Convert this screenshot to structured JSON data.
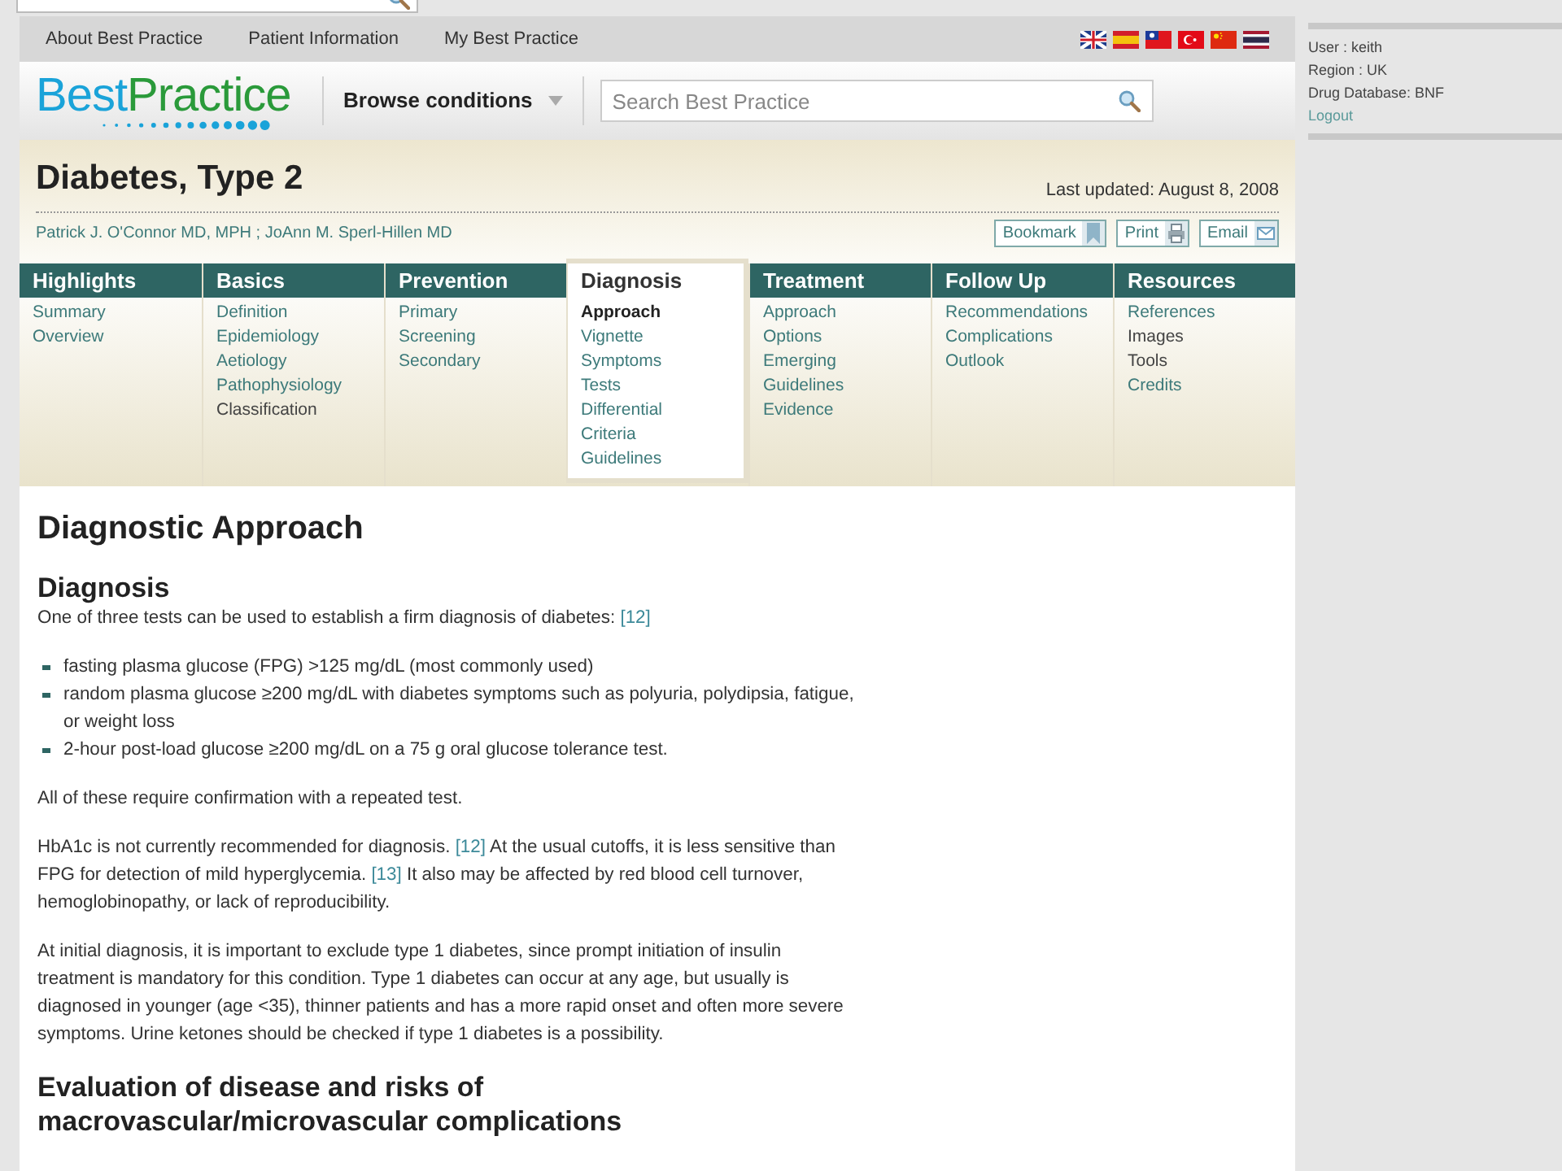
{
  "top_nav": [
    "About Best Practice",
    "Patient Information",
    "My Best Practice"
  ],
  "logo": {
    "part_1": "Best",
    "part_2": "Practice"
  },
  "browse": "Browse conditions",
  "search": {
    "placeholder": "Search Best Practice"
  },
  "title": "Diabetes, Type 2",
  "last_updated": "Last updated: August 8, 2008",
  "authors": "Patrick J. O'Connor MD, MPH ; JoAnn M. Sperl-Hillen MD",
  "actions": [
    "Bookmark",
    "Print",
    "Email"
  ],
  "menu": [
    {
      "heading": "Highlights",
      "selected": false,
      "items": [
        {
          "label": "Summary",
          "linked": true,
          "selected": false
        },
        {
          "label": "Overview",
          "linked": true,
          "selected": false
        }
      ]
    },
    {
      "heading": "Basics",
      "selected": false,
      "items": [
        {
          "label": "Definition",
          "linked": true,
          "selected": false
        },
        {
          "label": "Epidemiology",
          "linked": true,
          "selected": false
        },
        {
          "label": "Aetiology",
          "linked": true,
          "selected": false
        },
        {
          "label": "Pathophysiology",
          "linked": true,
          "selected": false
        },
        {
          "label": "Classification",
          "linked": false,
          "selected": false
        }
      ]
    },
    {
      "heading": "Prevention",
      "selected": false,
      "items": [
        {
          "label": "Primary",
          "linked": true,
          "selected": false
        },
        {
          "label": "Screening",
          "linked": true,
          "selected": false
        },
        {
          "label": "Secondary",
          "linked": true,
          "selected": false
        }
      ]
    },
    {
      "heading": "Diagnosis",
      "selected": true,
      "items": [
        {
          "label": "Approach",
          "linked": true,
          "selected": true
        },
        {
          "label": "Vignette",
          "linked": true,
          "selected": false
        },
        {
          "label": "Symptoms",
          "linked": true,
          "selected": false
        },
        {
          "label": "Tests",
          "linked": true,
          "selected": false
        },
        {
          "label": "Differential",
          "linked": true,
          "selected": false
        },
        {
          "label": "Criteria",
          "linked": true,
          "selected": false
        },
        {
          "label": "Guidelines",
          "linked": true,
          "selected": false
        }
      ]
    },
    {
      "heading": "Treatment",
      "selected": false,
      "items": [
        {
          "label": "Approach",
          "linked": true,
          "selected": false
        },
        {
          "label": "Options",
          "linked": true,
          "selected": false
        },
        {
          "label": "Emerging",
          "linked": true,
          "selected": false
        },
        {
          "label": "Guidelines",
          "linked": true,
          "selected": false
        },
        {
          "label": "Evidence",
          "linked": true,
          "selected": false
        }
      ]
    },
    {
      "heading": "Follow Up",
      "selected": false,
      "items": [
        {
          "label": "Recommendations",
          "linked": true,
          "selected": false
        },
        {
          "label": "Complications",
          "linked": true,
          "selected": false
        },
        {
          "label": "Outlook",
          "linked": true,
          "selected": false
        }
      ]
    },
    {
      "heading": "Resources",
      "selected": false,
      "items": [
        {
          "label": "References",
          "linked": true,
          "selected": false
        },
        {
          "label": "Images",
          "linked": false,
          "selected": false
        },
        {
          "label": "Tools",
          "linked": false,
          "selected": false
        },
        {
          "label": "Credits",
          "linked": true,
          "selected": false
        }
      ]
    }
  ],
  "content": [
    {
      "kind": "h1",
      "text": "Diagnostic Approach"
    },
    {
      "kind": "h2",
      "text": "Diagnosis"
    },
    {
      "kind": "p",
      "parts": [
        {
          "kind": "text",
          "text": "One of three tests can be used to establish a firm diagnosis of diabetes:"
        },
        {
          "kind": "ref",
          "text": "[12]"
        }
      ]
    },
    {
      "kind": "list",
      "items": [
        "fasting plasma glucose (FPG) >125 mg/dL (most commonly used)",
        "random plasma glucose ≥200 mg/dL with diabetes symptoms such as polyuria, polydipsia, fatigue, or weight loss",
        "2-hour post-load glucose ≥200 mg/dL on a 75 g oral glucose tolerance test."
      ]
    },
    {
      "kind": "p",
      "parts": [
        {
          "kind": "text",
          "text": "All of these require confirmation with a repeated test."
        }
      ]
    },
    {
      "kind": "p",
      "parts": [
        {
          "kind": "text",
          "text": "HbA1c is not currently recommended for diagnosis."
        },
        {
          "kind": "ref",
          "text": "[12]"
        },
        {
          "kind": "text",
          "text": "At the usual cutoffs, it is less sensitive than FPG for detection of mild hyperglycemia."
        },
        {
          "kind": "ref",
          "text": "[13]"
        },
        {
          "kind": "text",
          "text": "It also may be affected by red blood cell turnover, hemoglobinopathy, or lack of reproducibility."
        }
      ]
    },
    {
      "kind": "p",
      "parts": [
        {
          "kind": "text",
          "text": "At initial diagnosis, it is important to exclude type 1 diabetes, since prompt initiation of insulin treatment is mandatory for this condition. Type 1 diabetes can occur at any age, but usually is diagnosed in younger (age <35), thinner patients and has a more rapid onset and often more severe symptoms. Urine ketones should be checked if type 1 diabetes is a possibility."
        }
      ]
    },
    {
      "kind": "h2",
      "text": "Evaluation of disease and risks of macrovascular/microvascular complications"
    }
  ],
  "user_panel": {
    "lines": [
      "User : keith",
      "Region : UK",
      "Drug Database: BNF"
    ],
    "logout": "Logout"
  }
}
